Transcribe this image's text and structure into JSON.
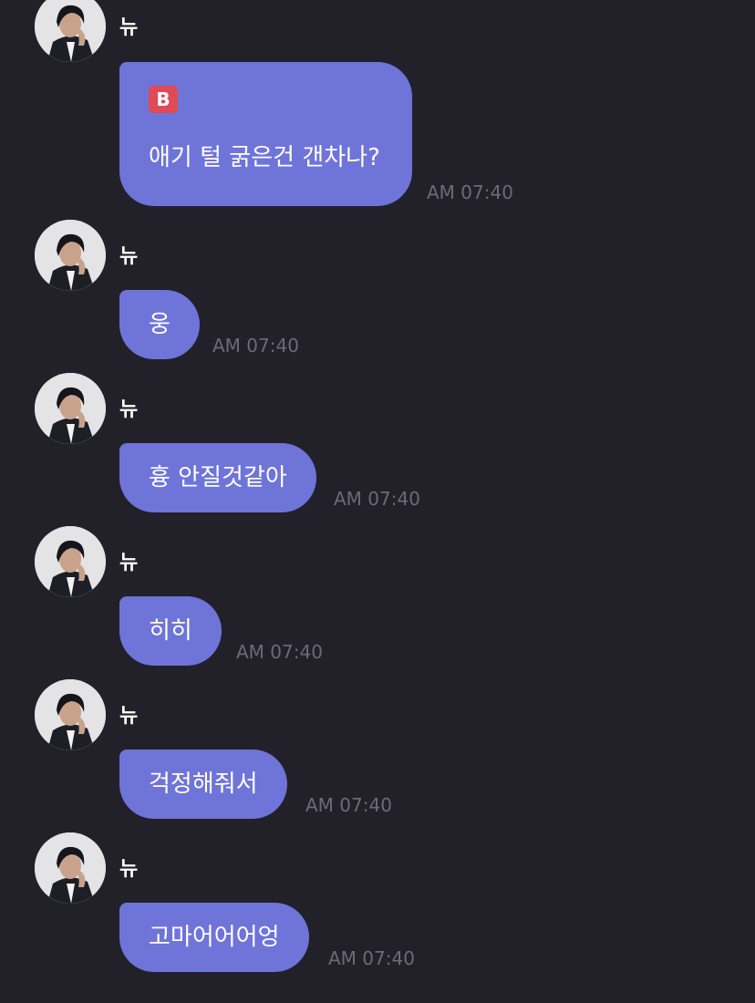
{
  "messages": [
    {
      "sender": "뉴",
      "badge": "B",
      "text": "애기 털 굵은건 갠차나?",
      "time": "AM 07:40"
    },
    {
      "sender": "뉴",
      "text": "웅",
      "time": "AM 07:40"
    },
    {
      "sender": "뉴",
      "text": "흉 안질것같아",
      "time": "AM 07:40"
    },
    {
      "sender": "뉴",
      "text": "히히",
      "time": "AM 07:40"
    },
    {
      "sender": "뉴",
      "text": "걱정해줘서",
      "time": "AM 07:40"
    },
    {
      "sender": "뉴",
      "text": "고마어어어엉",
      "time": "AM 07:40"
    }
  ],
  "colors": {
    "background": "#22212a",
    "bubble": "#6f74d9",
    "badge": "#e04a55",
    "timestamp": "#6c6b75"
  },
  "icons": {
    "badge": "b-square-icon",
    "avatar": "profile-photo"
  }
}
